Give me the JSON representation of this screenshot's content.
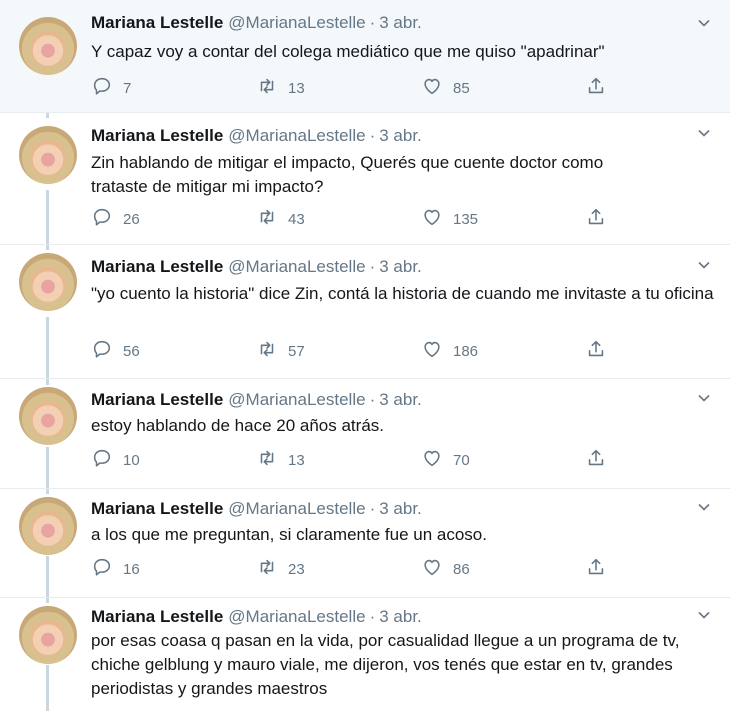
{
  "tweets": [
    {
      "author": "Mariana Lestelle",
      "handle": "@MarianaLestelle",
      "separator": "·",
      "date": "3 abr.",
      "text": "Y capaz voy a contar del colega mediático que me quiso \"apadrinar\"",
      "replies": "7",
      "retweets": "13",
      "likes": "85"
    },
    {
      "author": "Mariana Lestelle",
      "handle": "@MarianaLestelle",
      "separator": "·",
      "date": "3 abr.",
      "text": "Zin hablando de mitigar el impacto, Querés que cuente doctor como trataste de mitigar mi impacto?",
      "replies": "26",
      "retweets": "43",
      "likes": "135"
    },
    {
      "author": "Mariana Lestelle",
      "handle": "@MarianaLestelle",
      "separator": "·",
      "date": "3 abr.",
      "text": "\"yo cuento la historia\" dice Zin, contá la historia de cuando me invitaste a tu oficina",
      "replies": "56",
      "retweets": "57",
      "likes": "186"
    },
    {
      "author": "Mariana Lestelle",
      "handle": "@MarianaLestelle",
      "separator": "·",
      "date": "3 abr.",
      "text": "estoy hablando de hace 20 años atrás.",
      "replies": "10",
      "retweets": "13",
      "likes": "70"
    },
    {
      "author": "Mariana Lestelle",
      "handle": "@MarianaLestelle",
      "separator": "·",
      "date": "3 abr.",
      "text": "a los que me preguntan, si claramente fue un acoso.",
      "replies": "16",
      "retweets": "23",
      "likes": "86"
    },
    {
      "author": "Mariana Lestelle",
      "handle": "@MarianaLestelle",
      "separator": "·",
      "date": "3 abr.",
      "text": "por esas coasa q pasan en la vida, por casualidad llegue a un programa de tv, chiche gelblung y mauro viale, me dijeron, vos tenés que estar en tv, grandes periodistas y grandes maestros"
    }
  ],
  "icons": {
    "reply": "reply-icon",
    "retweet": "retweet-icon",
    "like": "heart-icon",
    "share": "share-icon",
    "menu": "chevron-down-icon"
  },
  "colors": {
    "text": "#14171a",
    "secondary": "#657786",
    "highlight_bg": "#f5f8fa",
    "thread_line": "#ccd6dd"
  }
}
